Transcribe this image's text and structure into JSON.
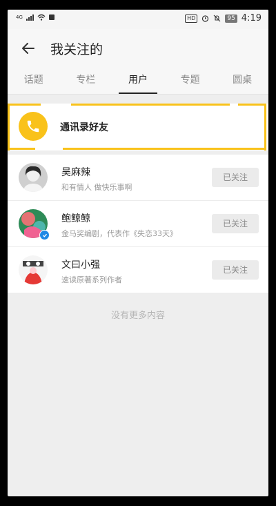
{
  "status_bar": {
    "signal_label": "4G",
    "hd_label": "HD",
    "battery": "95",
    "time": "4:19"
  },
  "header": {
    "title": "我关注的"
  },
  "tabs": [
    {
      "label": "话题"
    },
    {
      "label": "专栏"
    },
    {
      "label": "用户"
    },
    {
      "label": "专题"
    },
    {
      "label": "圆桌"
    }
  ],
  "contacts_entry": {
    "label": "通讯录好友"
  },
  "users": [
    {
      "name": "吴麻辣",
      "desc": "和有情人 做快乐事啊",
      "button": "已关注"
    },
    {
      "name": "鲍鲸鲸",
      "desc": "金马奖编剧，代表作《失恋33天》",
      "button": "已关注"
    },
    {
      "name": "文曰小强",
      "desc": "速读原著系列作者",
      "button": "已关注"
    }
  ],
  "footer": {
    "no_more": "没有更多内容"
  },
  "colors": {
    "accent": "#f9c21a",
    "verified": "#1e88e5"
  }
}
